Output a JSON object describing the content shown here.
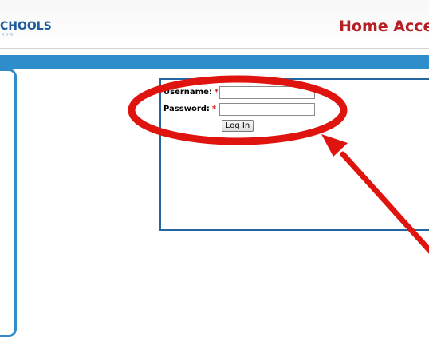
{
  "header": {
    "logo_text": "CHOOLS",
    "logo_subtext": "ROW",
    "page_heading": "Home Acces"
  },
  "login": {
    "username_label": "Username:",
    "password_label": "Password:",
    "required_marker": "*",
    "username_value": "",
    "password_value": "",
    "login_button_label": "Log In"
  },
  "colors": {
    "brand_blue": "#2f8dcc",
    "heading_red": "#b51f24",
    "annotation_red": "#e0140f"
  },
  "annotation": {
    "type": "red-ellipse-and-arrow",
    "target": "login-form"
  }
}
